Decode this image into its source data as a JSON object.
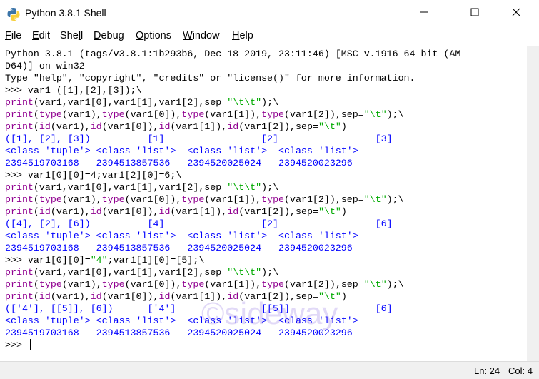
{
  "window": {
    "title": "Python 3.8.1 Shell",
    "icons": {
      "app": "python-icon",
      "minimize": "minimize-icon",
      "maximize": "maximize-icon",
      "close": "close-icon"
    }
  },
  "menu": {
    "items": [
      {
        "label": "File",
        "mnemonic": "F",
        "rest": "ile"
      },
      {
        "label": "Edit",
        "mnemonic": "E",
        "rest": "dit"
      },
      {
        "label": "Shell",
        "pre": "She",
        "mnemonic": "l",
        "rest": "l"
      },
      {
        "label": "Debug",
        "mnemonic": "D",
        "rest": "ebug"
      },
      {
        "label": "Options",
        "mnemonic": "O",
        "rest": "ptions"
      },
      {
        "label": "Window",
        "mnemonic": "W",
        "rest": "indow"
      },
      {
        "label": "Help",
        "mnemonic": "H",
        "rest": "elp"
      }
    ]
  },
  "colors": {
    "keyword": "#900090",
    "string": "#00aa00",
    "output": "#0000ff",
    "text": "#000000"
  },
  "shell": {
    "lines": [
      [
        {
          "t": "Python 3.8.1 (tags/v3.8.1:1b293b6, Dec 18 2019, 23:11:46) [MSC v.1916 64 bit (AM",
          "c": "plain"
        }
      ],
      [
        {
          "t": "D64)] on win32",
          "c": "plain"
        }
      ],
      [
        {
          "t": "Type \"help\", \"copyright\", \"credits\" or \"license()\" for more information.",
          "c": "plain"
        }
      ],
      [
        {
          "t": ">>> ",
          "c": "plain"
        },
        {
          "t": "var1=([1],[2],[3]);\\",
          "c": "plain"
        }
      ],
      [
        {
          "t": "print",
          "c": "kw"
        },
        {
          "t": "(var1,var1[0],var1[1],var1[2],sep=",
          "c": "plain"
        },
        {
          "t": "\"\\t\\t\"",
          "c": "str"
        },
        {
          "t": ");\\",
          "c": "plain"
        }
      ],
      [
        {
          "t": "print",
          "c": "kw"
        },
        {
          "t": "(",
          "c": "plain"
        },
        {
          "t": "type",
          "c": "kw"
        },
        {
          "t": "(var1),",
          "c": "plain"
        },
        {
          "t": "type",
          "c": "kw"
        },
        {
          "t": "(var1[0]),",
          "c": "plain"
        },
        {
          "t": "type",
          "c": "kw"
        },
        {
          "t": "(var1[1]),",
          "c": "plain"
        },
        {
          "t": "type",
          "c": "kw"
        },
        {
          "t": "(var1[2]),sep=",
          "c": "plain"
        },
        {
          "t": "\"\\t\"",
          "c": "str"
        },
        {
          "t": ");\\",
          "c": "plain"
        }
      ],
      [
        {
          "t": "print",
          "c": "kw"
        },
        {
          "t": "(",
          "c": "plain"
        },
        {
          "t": "id",
          "c": "kw"
        },
        {
          "t": "(var1),",
          "c": "plain"
        },
        {
          "t": "id",
          "c": "kw"
        },
        {
          "t": "(var1[0]),",
          "c": "plain"
        },
        {
          "t": "id",
          "c": "kw"
        },
        {
          "t": "(var1[1]),",
          "c": "plain"
        },
        {
          "t": "id",
          "c": "kw"
        },
        {
          "t": "(var1[2]),sep=",
          "c": "plain"
        },
        {
          "t": "\"\\t\"",
          "c": "str"
        },
        {
          "t": ")",
          "c": "plain"
        }
      ],
      [
        {
          "t": "([1], [2], [3])          [1]                 [2]                 [3]",
          "c": "out"
        }
      ],
      [
        {
          "t": "<class 'tuple'> <class 'list'>  <class 'list'>  <class 'list'>",
          "c": "out"
        }
      ],
      [
        {
          "t": "2394519703168   2394513857536   2394520025024   2394520023296",
          "c": "out"
        }
      ],
      [
        {
          "t": ">>> ",
          "c": "plain"
        },
        {
          "t": "var1[0][0]=4;var1[2][0]=6;\\",
          "c": "plain"
        }
      ],
      [
        {
          "t": "print",
          "c": "kw"
        },
        {
          "t": "(var1,var1[0],var1[1],var1[2],sep=",
          "c": "plain"
        },
        {
          "t": "\"\\t\\t\"",
          "c": "str"
        },
        {
          "t": ");\\",
          "c": "plain"
        }
      ],
      [
        {
          "t": "print",
          "c": "kw"
        },
        {
          "t": "(",
          "c": "plain"
        },
        {
          "t": "type",
          "c": "kw"
        },
        {
          "t": "(var1),",
          "c": "plain"
        },
        {
          "t": "type",
          "c": "kw"
        },
        {
          "t": "(var1[0]),",
          "c": "plain"
        },
        {
          "t": "type",
          "c": "kw"
        },
        {
          "t": "(var1[1]),",
          "c": "plain"
        },
        {
          "t": "type",
          "c": "kw"
        },
        {
          "t": "(var1[2]),sep=",
          "c": "plain"
        },
        {
          "t": "\"\\t\"",
          "c": "str"
        },
        {
          "t": ");\\",
          "c": "plain"
        }
      ],
      [
        {
          "t": "print",
          "c": "kw"
        },
        {
          "t": "(",
          "c": "plain"
        },
        {
          "t": "id",
          "c": "kw"
        },
        {
          "t": "(var1),",
          "c": "plain"
        },
        {
          "t": "id",
          "c": "kw"
        },
        {
          "t": "(var1[0]),",
          "c": "plain"
        },
        {
          "t": "id",
          "c": "kw"
        },
        {
          "t": "(var1[1]),",
          "c": "plain"
        },
        {
          "t": "id",
          "c": "kw"
        },
        {
          "t": "(var1[2]),sep=",
          "c": "plain"
        },
        {
          "t": "\"\\t\"",
          "c": "str"
        },
        {
          "t": ")",
          "c": "plain"
        }
      ],
      [
        {
          "t": "([4], [2], [6])          [4]                 [2]                 [6]",
          "c": "out"
        }
      ],
      [
        {
          "t": "<class 'tuple'> <class 'list'>  <class 'list'>  <class 'list'>",
          "c": "out"
        }
      ],
      [
        {
          "t": "2394519703168   2394513857536   2394520025024   2394520023296",
          "c": "out"
        }
      ],
      [
        {
          "t": ">>> ",
          "c": "plain"
        },
        {
          "t": "var1[0][0]=",
          "c": "plain"
        },
        {
          "t": "\"4\"",
          "c": "str"
        },
        {
          "t": ";var1[1][0]=[5];\\",
          "c": "plain"
        }
      ],
      [
        {
          "t": "print",
          "c": "kw"
        },
        {
          "t": "(var1,var1[0],var1[1],var1[2],sep=",
          "c": "plain"
        },
        {
          "t": "\"\\t\\t\"",
          "c": "str"
        },
        {
          "t": ");\\",
          "c": "plain"
        }
      ],
      [
        {
          "t": "print",
          "c": "kw"
        },
        {
          "t": "(",
          "c": "plain"
        },
        {
          "t": "type",
          "c": "kw"
        },
        {
          "t": "(var1),",
          "c": "plain"
        },
        {
          "t": "type",
          "c": "kw"
        },
        {
          "t": "(var1[0]),",
          "c": "plain"
        },
        {
          "t": "type",
          "c": "kw"
        },
        {
          "t": "(var1[1]),",
          "c": "plain"
        },
        {
          "t": "type",
          "c": "kw"
        },
        {
          "t": "(var1[2]),sep=",
          "c": "plain"
        },
        {
          "t": "\"\\t\"",
          "c": "str"
        },
        {
          "t": ");\\",
          "c": "plain"
        }
      ],
      [
        {
          "t": "print",
          "c": "kw"
        },
        {
          "t": "(",
          "c": "plain"
        },
        {
          "t": "id",
          "c": "kw"
        },
        {
          "t": "(var1),",
          "c": "plain"
        },
        {
          "t": "id",
          "c": "kw"
        },
        {
          "t": "(var1[0]),",
          "c": "plain"
        },
        {
          "t": "id",
          "c": "kw"
        },
        {
          "t": "(var1[1]),",
          "c": "plain"
        },
        {
          "t": "id",
          "c": "kw"
        },
        {
          "t": "(var1[2]),sep=",
          "c": "plain"
        },
        {
          "t": "\"\\t\"",
          "c": "str"
        },
        {
          "t": ")",
          "c": "plain"
        }
      ],
      [
        {
          "t": "(['4'], [[5]], [6])      ['4']               [[5]]               [6]",
          "c": "out"
        }
      ],
      [
        {
          "t": "<class 'tuple'> <class 'list'>  <class 'list'>  <class 'list'>",
          "c": "out"
        }
      ],
      [
        {
          "t": "2394519703168   2394513857536   2394520025024   2394520023296",
          "c": "out"
        }
      ],
      [
        {
          "t": ">>> ",
          "c": "plain"
        }
      ]
    ],
    "watermark": "©sideway"
  },
  "status": {
    "line": "Ln: 24",
    "col": "Col: 4"
  }
}
